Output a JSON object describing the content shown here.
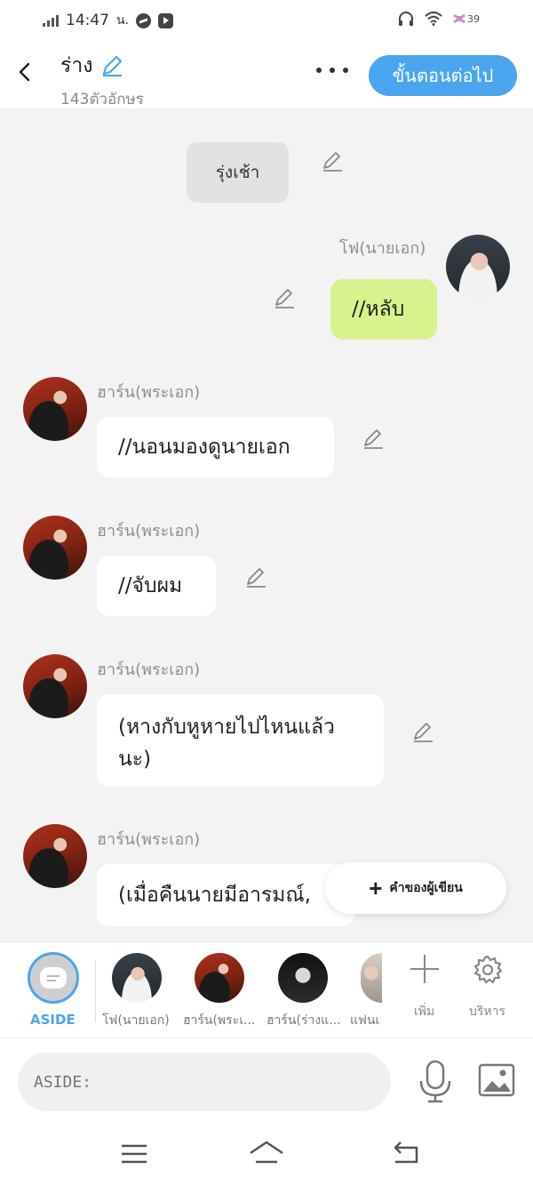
{
  "status_bar": {
    "time": "14:47",
    "carrier_mark": "น.",
    "battery": "39"
  },
  "header": {
    "title": "ร่าง",
    "subtitle": "143ตัวอักษร",
    "next_button": "ขั้นตอนต่อไป"
  },
  "chat": {
    "scene_label": "รุ่งเช้า",
    "messages": [
      {
        "speaker": "โฟ(นายเอก)",
        "text": "//หลับ"
      },
      {
        "speaker": "ฮาร์น(พระเอก)",
        "text": "//นอนมองดูนายเอก"
      },
      {
        "speaker": "ฮาร์น(พระเอก)",
        "text": "//จับผม"
      },
      {
        "speaker": "ฮาร์น(พระเอก)",
        "text": "(หางกับหูหายไปไหนแล้วนะ)"
      },
      {
        "speaker": "ฮาร์น(พระเอก)",
        "text": "(เมื่อคืนนายมีอารมณ์,"
      }
    ],
    "author_note_button": "คำของผู้เขียน"
  },
  "character_bar": {
    "aside_label": "ASIDE",
    "characters": [
      {
        "label": "โฟ(นายเอก)"
      },
      {
        "label": "ฮาร์น(พระเ..."
      },
      {
        "label": "ฮาร์น(ร่างแ..."
      },
      {
        "label": "แฟนเ"
      }
    ],
    "add_label": "เพิ่ม",
    "manage_label": "บริหาร"
  },
  "input": {
    "placeholder": "ASIDE:"
  },
  "colors": {
    "accent": "#4aa5ef",
    "mine_bubble": "#d8f28e",
    "scene_bg": "#e2e2e2",
    "chat_bg": "#f3f3f3"
  }
}
